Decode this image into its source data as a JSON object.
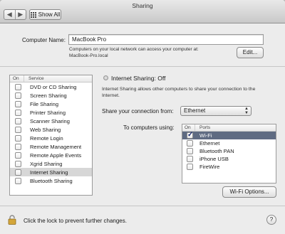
{
  "window": {
    "title": "Sharing"
  },
  "toolbar": {
    "back_glyph": "◀",
    "forward_glyph": "▶",
    "show_all_label": "Show All"
  },
  "computer": {
    "name_label": "Computer Name:",
    "name_value": "MacBook Pro",
    "hint_line1": "Computers on your local network can access your computer at:",
    "hint_line2": "MacBook-Pro.local",
    "edit_label": "Edit..."
  },
  "services": {
    "header_on": "On",
    "header_service": "Service",
    "items": [
      {
        "label": "DVD or CD Sharing",
        "on": false
      },
      {
        "label": "Screen Sharing",
        "on": false
      },
      {
        "label": "File Sharing",
        "on": false
      },
      {
        "label": "Printer Sharing",
        "on": false
      },
      {
        "label": "Scanner Sharing",
        "on": false
      },
      {
        "label": "Web Sharing",
        "on": false
      },
      {
        "label": "Remote Login",
        "on": false
      },
      {
        "label": "Remote Management",
        "on": false
      },
      {
        "label": "Remote Apple Events",
        "on": false
      },
      {
        "label": "Xgrid Sharing",
        "on": false
      },
      {
        "label": "Internet Sharing",
        "on": false,
        "selected": true
      },
      {
        "label": "Bluetooth Sharing",
        "on": false
      }
    ]
  },
  "detail": {
    "status": "Internet Sharing: Off",
    "description_line1": "Internet Sharing allows other computers to share your connection to the",
    "description_line2": "Internet.",
    "share_from_label": "Share your connection from:",
    "share_from_value": "Ethernet",
    "to_computers_label": "To computers using:",
    "ports_header_on": "On",
    "ports_header_ports": "Ports",
    "ports": [
      {
        "label": "Wi-Fi",
        "on": true,
        "selected": true
      },
      {
        "label": "Ethernet",
        "on": false
      },
      {
        "label": "Bluetooth PAN",
        "on": false
      },
      {
        "label": "iPhone USB",
        "on": false
      },
      {
        "label": "FireWire",
        "on": false
      }
    ],
    "wifi_options_label": "Wi-Fi Options..."
  },
  "footer": {
    "lock_text": "Click the lock to prevent further changes.",
    "help_glyph": "?"
  },
  "colors": {
    "selected_port_row": "#5f6b82",
    "selected_service_row": "#d7d7d7"
  }
}
